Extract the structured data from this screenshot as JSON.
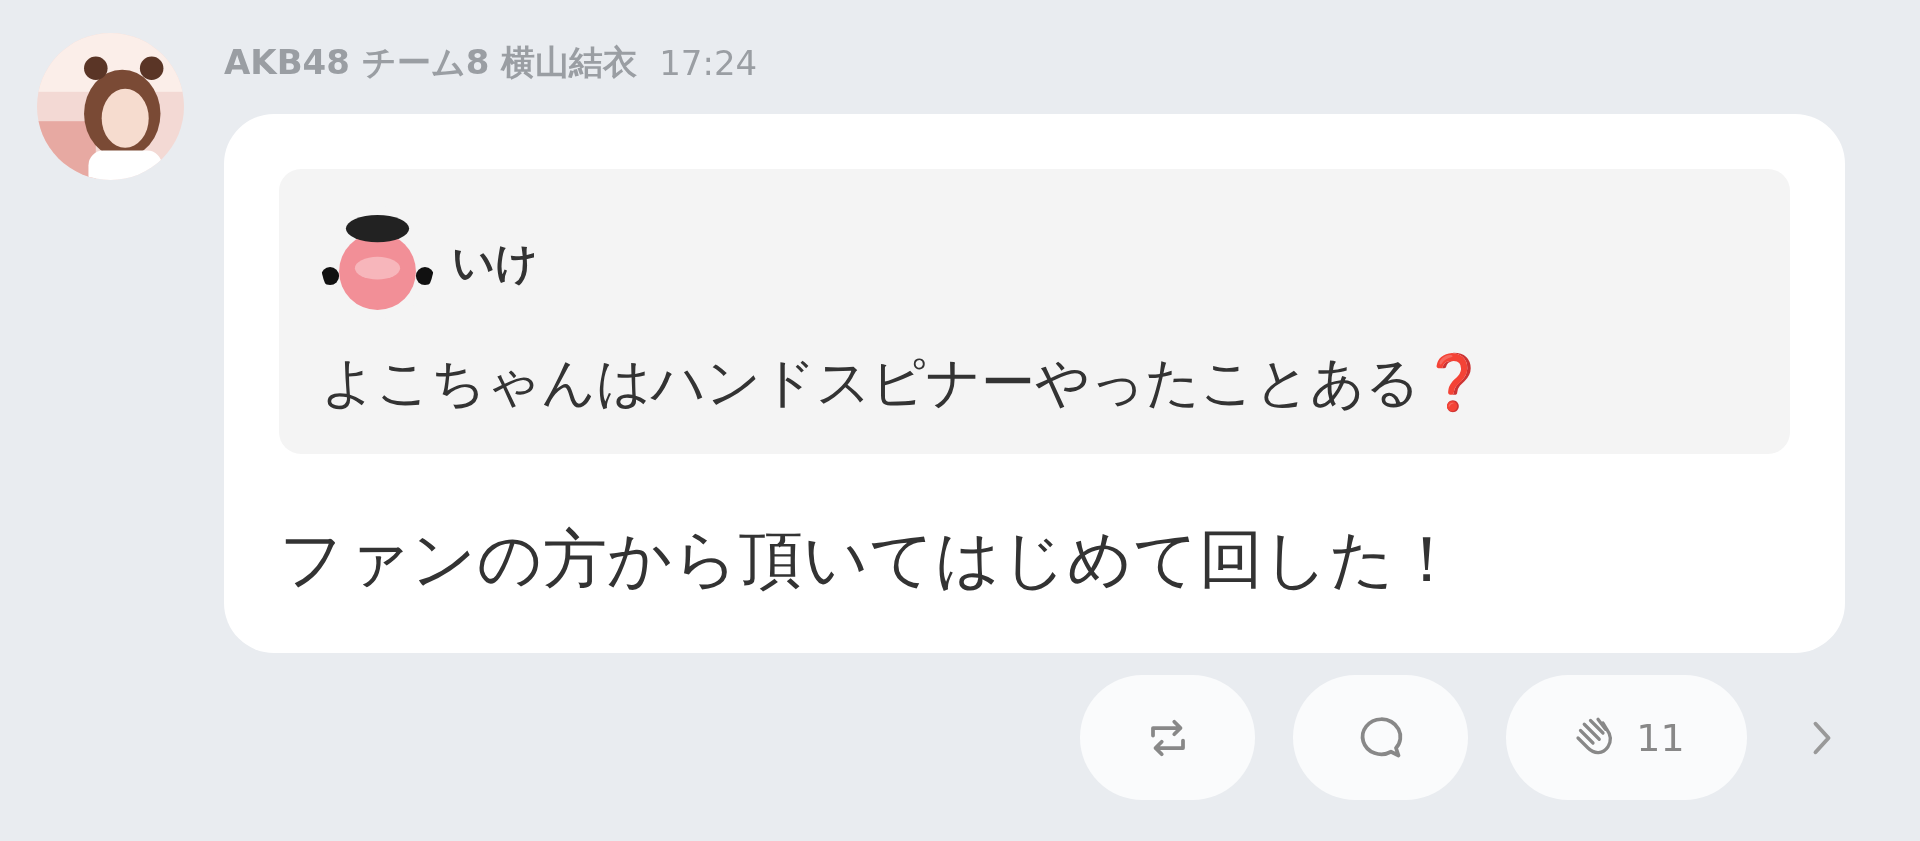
{
  "post": {
    "author": "AKB48 チーム8 横山結衣",
    "time": "17:24",
    "quote": {
      "author": "いけ",
      "text": "よこちゃんはハンドスピナーやったことある",
      "mark": "❓"
    },
    "text": "ファンの方から頂いてはじめて回した！"
  },
  "actions": [
    {
      "kind": "repost"
    },
    {
      "kind": "comment"
    },
    {
      "kind": "clap",
      "count": "11"
    }
  ]
}
